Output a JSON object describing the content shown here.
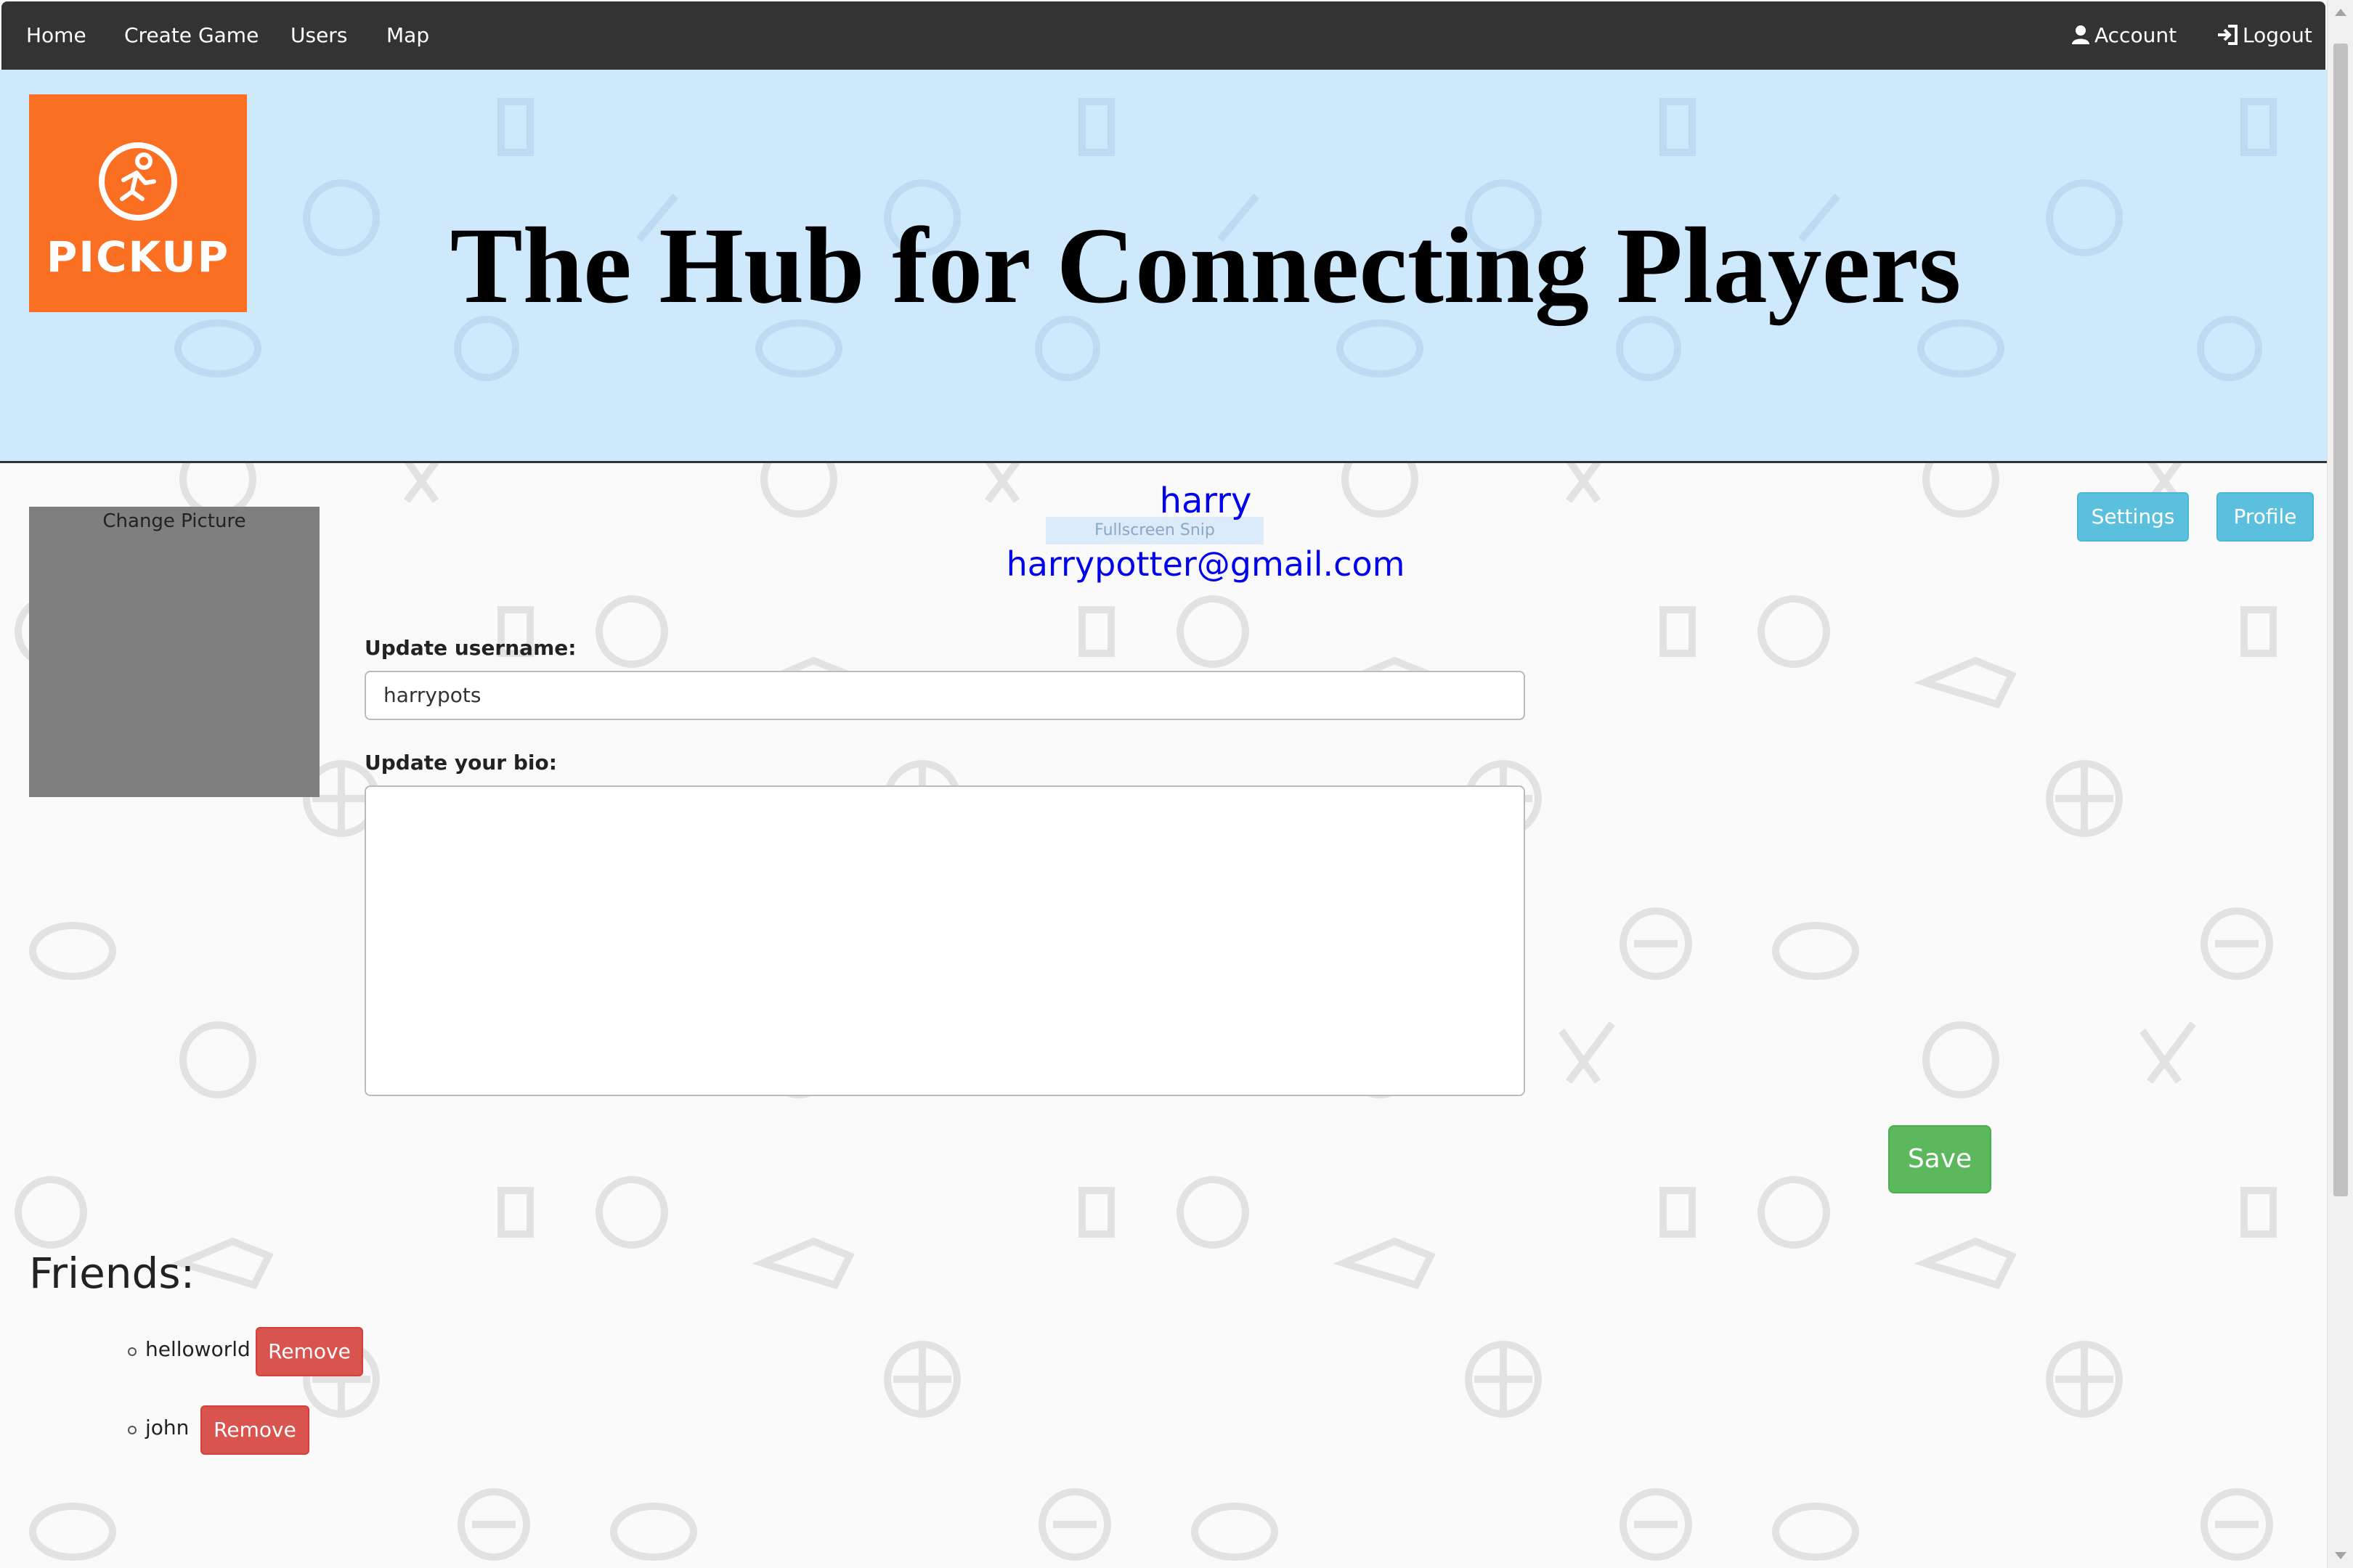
{
  "nav": {
    "home": "Home",
    "create_game": "Create Game",
    "users": "Users",
    "map": "Map",
    "account": "Account",
    "logout": "Logout"
  },
  "brand": {
    "logo_text": "PICKUP",
    "logo_color": "#fb6f23",
    "hero_title": "The Hub for Connecting Players"
  },
  "profile": {
    "change_picture": "Change Picture",
    "username": "harry",
    "email": "harrypotter@gmail.com",
    "overlay_text": "Fullscreen Snip",
    "settings_button": "Settings",
    "profile_button": "Profile"
  },
  "form": {
    "username_label": "Update username:",
    "username_value": "harrypots",
    "bio_label": "Update your bio:",
    "bio_value": "",
    "save_button": "Save"
  },
  "friends": {
    "title": "Friends:",
    "remove_label": "Remove",
    "items": [
      {
        "name": "helloworld"
      },
      {
        "name": "john"
      }
    ]
  },
  "colors": {
    "navbar": "#333333",
    "header_bg": "#cfe9fc",
    "info": "#5bc0de",
    "success": "#5cb85c",
    "danger": "#d9534f",
    "link": "#0000ee"
  }
}
